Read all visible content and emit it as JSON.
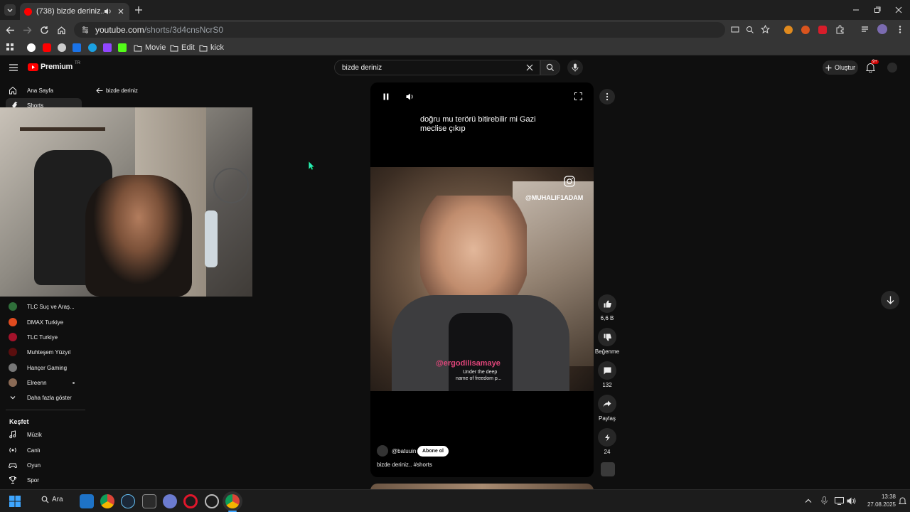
{
  "browser": {
    "tab_title": "(738) bizde deriniz.. #shorts",
    "url_host": "youtube.com",
    "url_path": "/shorts/3d4cnsNcrS0",
    "bookmarks": [
      "Movie",
      "Edit",
      "kick"
    ]
  },
  "youtube": {
    "logo_text": "Premium",
    "logo_badge": "TR",
    "search_value": "bizde deriniz",
    "create_label": "Oluştur",
    "notification_count": "9+",
    "back_label": "bizde deriniz",
    "sidebar": {
      "home": "Ana Sayfa",
      "shorts": "Shorts",
      "subscriptions": [
        {
          "name": "TLC Suç ve Araş..."
        },
        {
          "name": "DMAX Turkiye"
        },
        {
          "name": "TLC Turkiye"
        },
        {
          "name": "Muhteşem Yüzyıl"
        },
        {
          "name": "Hançer Gaming"
        },
        {
          "name": "Elreenn"
        }
      ],
      "show_more": "Daha fazla göster",
      "explore_title": "Keşfet",
      "explore": [
        "Müzik",
        "Canlı",
        "Oyun",
        "Spor"
      ]
    },
    "short": {
      "caption": "doğru mu terörü bitirebilir mi Gazi meclise çıkıp",
      "watermark": "@MUHALIF1ADAM",
      "overlay_text": "@ergodilisamaye",
      "subtitle_line1": "Under the deep",
      "subtitle_line2": "name of freedom p...",
      "channel": "@batuuin",
      "subscribe_label": "Abone ol",
      "title": "bizde deriniz.. #shorts"
    },
    "actions": {
      "likes": "6,6 B",
      "dislike": "Beğenme",
      "comments": "132",
      "share": "Paylaş",
      "remix": "24"
    }
  },
  "taskbar": {
    "search_label": "Ara",
    "time": "13:38",
    "date": "27.08.2025"
  },
  "colors": {
    "yt_red": "#ff0000",
    "page_bg": "#0f0f0f",
    "chrome_bg": "#353535"
  }
}
